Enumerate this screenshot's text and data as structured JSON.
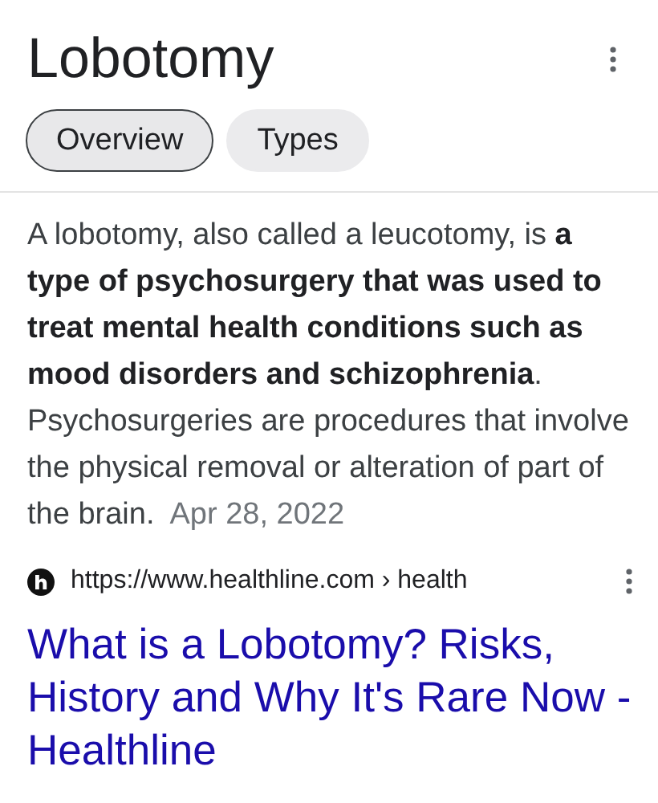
{
  "title": "Lobotomy",
  "tabs": [
    {
      "label": "Overview",
      "selected": true
    },
    {
      "label": "Types",
      "selected": false
    }
  ],
  "snippet": {
    "text": "A lobotomy, also called a leucotomy, is **a type of psychosurgery that was used to treat mental health conditions such as mood disorders and schizophrenia**. Psychosurgeries are procedures that involve the physical removal or alteration of part of the brain.",
    "date": "Apr 28, 2022"
  },
  "source": {
    "url": "https://www.healthline.com › health"
  },
  "result_title": "What is a Lobotomy? Risks, History and Why It's Rare Now - Healthline"
}
